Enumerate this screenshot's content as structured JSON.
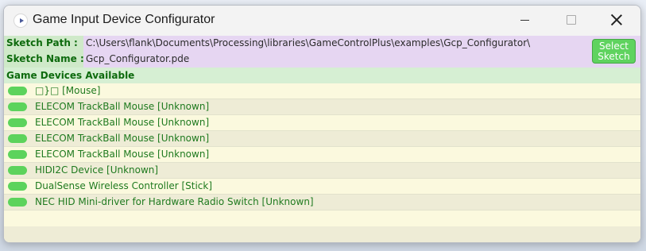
{
  "window": {
    "title": "Game Input Device Configurator"
  },
  "sketch": {
    "path_label": "Sketch Path :",
    "path_value": "C:\\Users\\flank\\Documents\\Processing\\libraries\\GameControlPlus\\examples\\Gcp_Configurator\\",
    "name_label": "Sketch Name :",
    "name_value": "Gcp_Configurator.pde",
    "select_button": [
      "Select",
      "Sketch"
    ]
  },
  "devices": {
    "header": "Game Devices Available",
    "items": [
      {
        "name": "□}□  [Mouse]"
      },
      {
        "name": "ELECOM TrackBall Mouse  [Unknown]"
      },
      {
        "name": "ELECOM TrackBall Mouse  [Unknown]"
      },
      {
        "name": "ELECOM TrackBall Mouse  [Unknown]"
      },
      {
        "name": "ELECOM TrackBall Mouse  [Unknown]"
      },
      {
        "name": "HIDI2C Device  [Unknown]"
      },
      {
        "name": "DualSense Wireless Controller  [Stick]"
      },
      {
        "name": "NEC HID Mini-driver for Hardware Radio Switch  [Unknown]"
      }
    ]
  },
  "colors": {
    "label_green": "#0d6a0d",
    "toggle_green": "#5cd35c",
    "sketch_panel_purple": "#e6d6f2",
    "header_green": "#d6efd3"
  }
}
